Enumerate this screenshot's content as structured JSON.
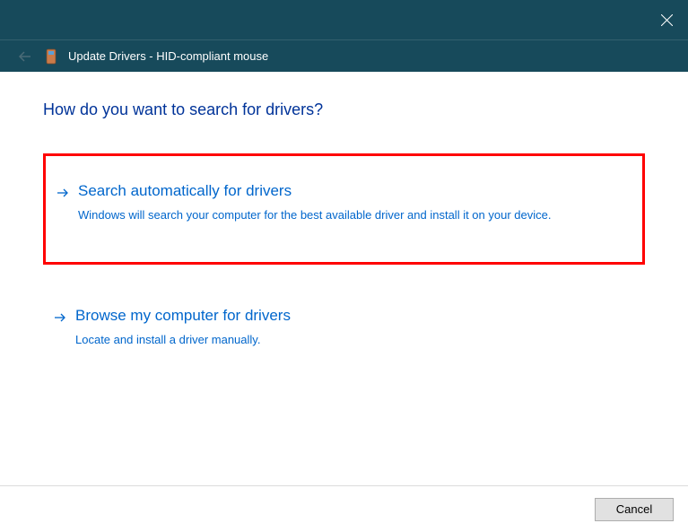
{
  "titlebar": {
    "close_icon": "close"
  },
  "breadcrumb": {
    "title": "Update Drivers - HID-compliant mouse"
  },
  "heading": "How do you want to search for drivers?",
  "options": [
    {
      "title": "Search automatically for drivers",
      "description": "Windows will search your computer for the best available driver and install it on your device."
    },
    {
      "title": "Browse my computer for drivers",
      "description": "Locate and install a driver manually."
    }
  ],
  "footer": {
    "cancel_label": "Cancel"
  },
  "colors": {
    "titlebar_bg": "#174a5b",
    "link_blue": "#0066cc",
    "heading_blue": "#003399",
    "highlight_red": "#ff0000"
  }
}
